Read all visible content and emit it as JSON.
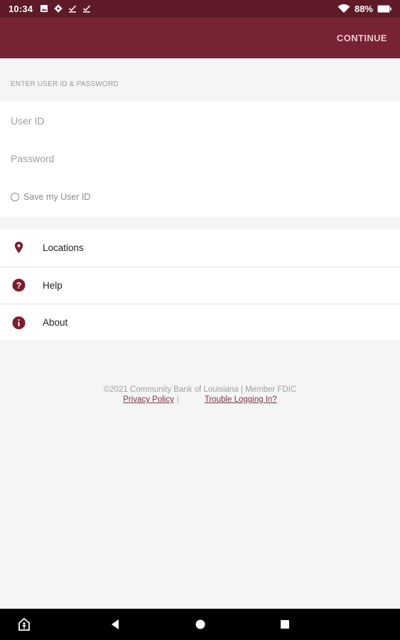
{
  "status_bar": {
    "time": "10:34",
    "battery": "88%",
    "icons": [
      "image-icon",
      "settings-icon",
      "check-download-icon",
      "check-download-icon",
      "wifi-icon",
      "battery-icon"
    ]
  },
  "app_bar": {
    "continue_label": "CONTINUE"
  },
  "login": {
    "section_label": "ENTER USER ID & PASSWORD",
    "user_id_placeholder": "User ID",
    "password_placeholder": "Password",
    "save_label": "Save my User ID"
  },
  "menu": {
    "items": [
      {
        "label": "Locations",
        "icon": "location-pin-icon"
      },
      {
        "label": "Help",
        "icon": "help-icon"
      },
      {
        "label": "About",
        "icon": "info-icon"
      }
    ]
  },
  "footer": {
    "copyright": "©2021 Community Bank of Louisiana | Member FDIC",
    "privacy": "Privacy Policy",
    "separator": "|",
    "trouble": "Trouble Logging In?"
  },
  "colors": {
    "status_bar": "#5e1a27",
    "app_bar": "#772333",
    "accent": "#7a1e2e"
  }
}
